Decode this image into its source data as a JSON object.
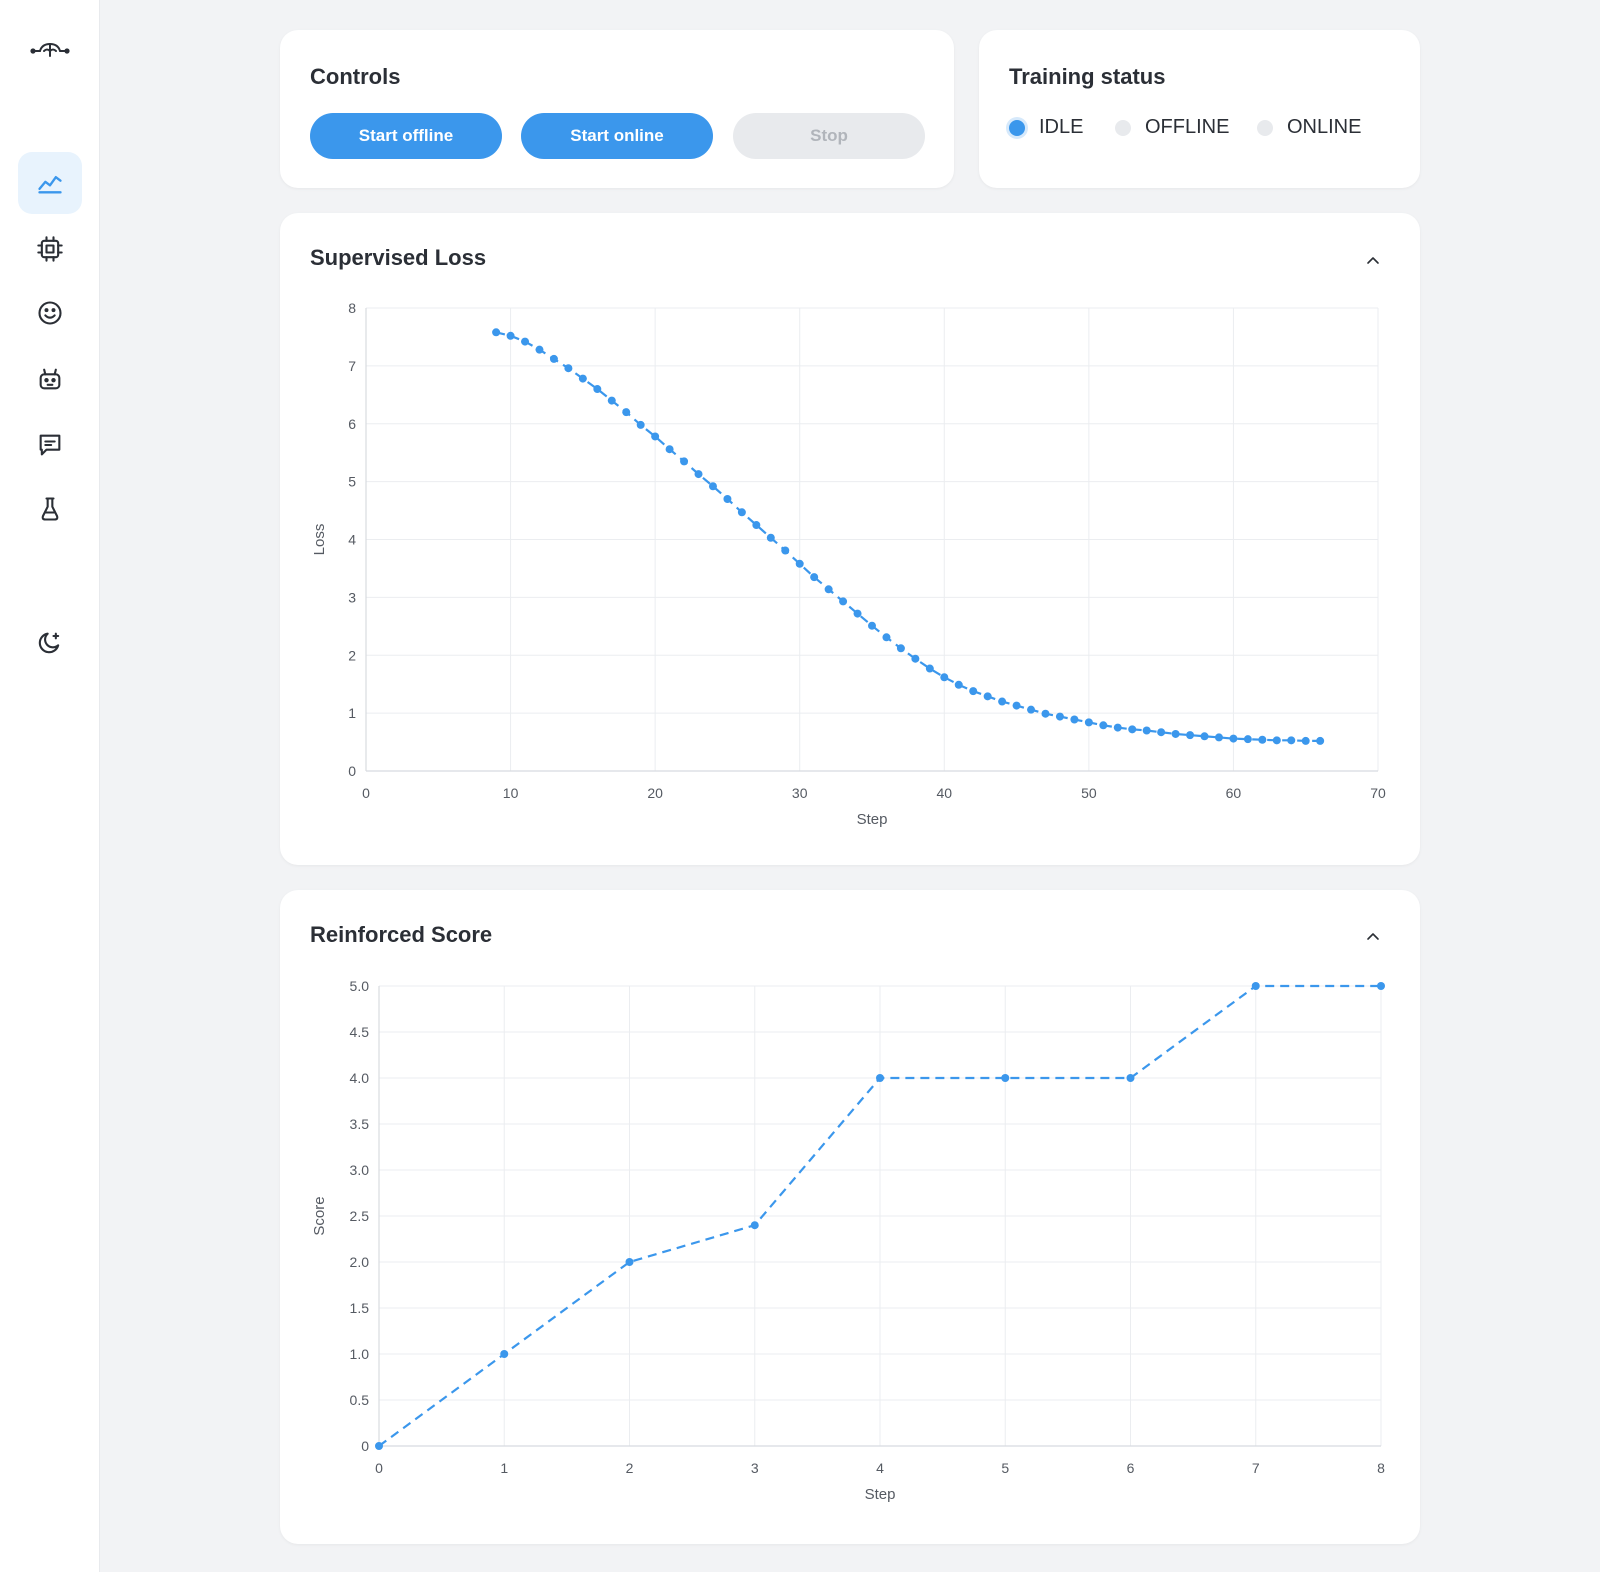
{
  "sidebar": {
    "logo_icon": "brain-logo-icon",
    "items": [
      {
        "icon": "chart-line-icon",
        "active": true
      },
      {
        "icon": "cpu-icon",
        "active": false
      },
      {
        "icon": "smiley-icon",
        "active": false
      },
      {
        "icon": "robot-icon",
        "active": false
      },
      {
        "icon": "chat-icon",
        "active": false
      },
      {
        "icon": "flask-icon",
        "active": false
      }
    ],
    "theme_icon": "moon-stars-icon"
  },
  "controls": {
    "title": "Controls",
    "start_offline_label": "Start offline",
    "start_online_label": "Start online",
    "stop_label": "Stop"
  },
  "status": {
    "title": "Training status",
    "items": [
      {
        "label": "IDLE",
        "active": true
      },
      {
        "label": "OFFLINE",
        "active": false
      },
      {
        "label": "ONLINE",
        "active": false
      }
    ]
  },
  "colors": {
    "accent": "#3b97ec",
    "disabled_bg": "#e8eaed",
    "disabled_text": "#b1b5bb",
    "grid": "#ebedf0"
  },
  "chart_data": [
    {
      "type": "line",
      "title": "Supervised Loss",
      "xlabel": "Step",
      "ylabel": "Loss",
      "xlim": [
        0,
        70
      ],
      "ylim": [
        0,
        8
      ],
      "xticks": [
        "0",
        "10",
        "20",
        "30",
        "40",
        "50",
        "60",
        "70"
      ],
      "yticks": [
        "0",
        "1",
        "2",
        "3",
        "4",
        "5",
        "6",
        "7",
        "8"
      ],
      "grid": true,
      "line_style": "dashed",
      "series": [
        {
          "x": [
            9,
            10,
            11,
            12,
            13,
            14,
            15,
            16,
            17,
            18,
            19,
            20,
            21,
            22,
            23,
            24,
            25,
            26,
            27,
            28,
            29,
            30,
            31,
            32,
            33,
            34,
            35,
            36,
            37,
            38,
            39,
            40,
            41,
            42,
            43,
            44,
            45,
            46,
            47,
            48,
            49,
            50,
            51,
            52,
            53,
            54,
            55,
            56,
            57,
            58,
            59,
            60,
            61,
            62,
            63,
            64,
            65,
            66
          ],
          "values": [
            7.58,
            7.52,
            7.42,
            7.28,
            7.12,
            6.96,
            6.78,
            6.6,
            6.4,
            6.2,
            5.98,
            5.78,
            5.56,
            5.35,
            5.13,
            4.92,
            4.7,
            4.47,
            4.25,
            4.03,
            3.81,
            3.58,
            3.35,
            3.14,
            2.93,
            2.72,
            2.51,
            2.31,
            2.12,
            1.94,
            1.77,
            1.62,
            1.49,
            1.38,
            1.29,
            1.2,
            1.13,
            1.06,
            0.99,
            0.94,
            0.89,
            0.84,
            0.79,
            0.75,
            0.72,
            0.7,
            0.67,
            0.64,
            0.62,
            0.6,
            0.58,
            0.56,
            0.55,
            0.54,
            0.53,
            0.53,
            0.52,
            0.52
          ]
        }
      ]
    },
    {
      "type": "line",
      "title": "Reinforced Score",
      "xlabel": "Step",
      "ylabel": "Score",
      "xlim": [
        0,
        8
      ],
      "ylim": [
        0,
        5
      ],
      "xticks": [
        "0",
        "1",
        "2",
        "3",
        "4",
        "5",
        "6",
        "7",
        "8"
      ],
      "yticks": [
        "0",
        "0.5",
        "1.0",
        "1.5",
        "2.0",
        "2.5",
        "3.0",
        "3.5",
        "4.0",
        "4.5",
        "5.0"
      ],
      "grid": true,
      "line_style": "dashed",
      "series": [
        {
          "x": [
            0,
            1,
            2,
            3,
            4,
            5,
            6,
            7,
            8
          ],
          "values": [
            0,
            1,
            2,
            2.4,
            4,
            4,
            4,
            5,
            5
          ]
        }
      ]
    }
  ]
}
